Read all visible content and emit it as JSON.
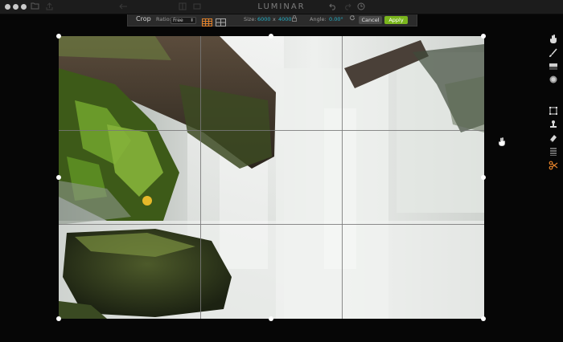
{
  "app": {
    "title": "LUMINAR"
  },
  "crop_toolbar": {
    "title": "Crop",
    "ratio_label": "Ratio:",
    "ratio_value": "Free",
    "size_label": "Size:",
    "width": "6000",
    "times": "x",
    "height": "4000",
    "angle_label": "Angle:",
    "angle_value": "0.00°",
    "cancel_label": "Cancel",
    "apply_label": "Apply"
  },
  "colors": {
    "accent_teal": "#23b0c7",
    "apply_green": "#7ab51d",
    "active_tool_orange": "#e0802a",
    "grid_button_orange": "#e0802a"
  },
  "side_tools": [
    "hand-icon",
    "brush-icon",
    "gradient-icon",
    "radial-mask-icon",
    "crop-icon",
    "clone-stamp-icon",
    "eraser-icon",
    "layers-icon",
    "scissors-icon"
  ]
}
